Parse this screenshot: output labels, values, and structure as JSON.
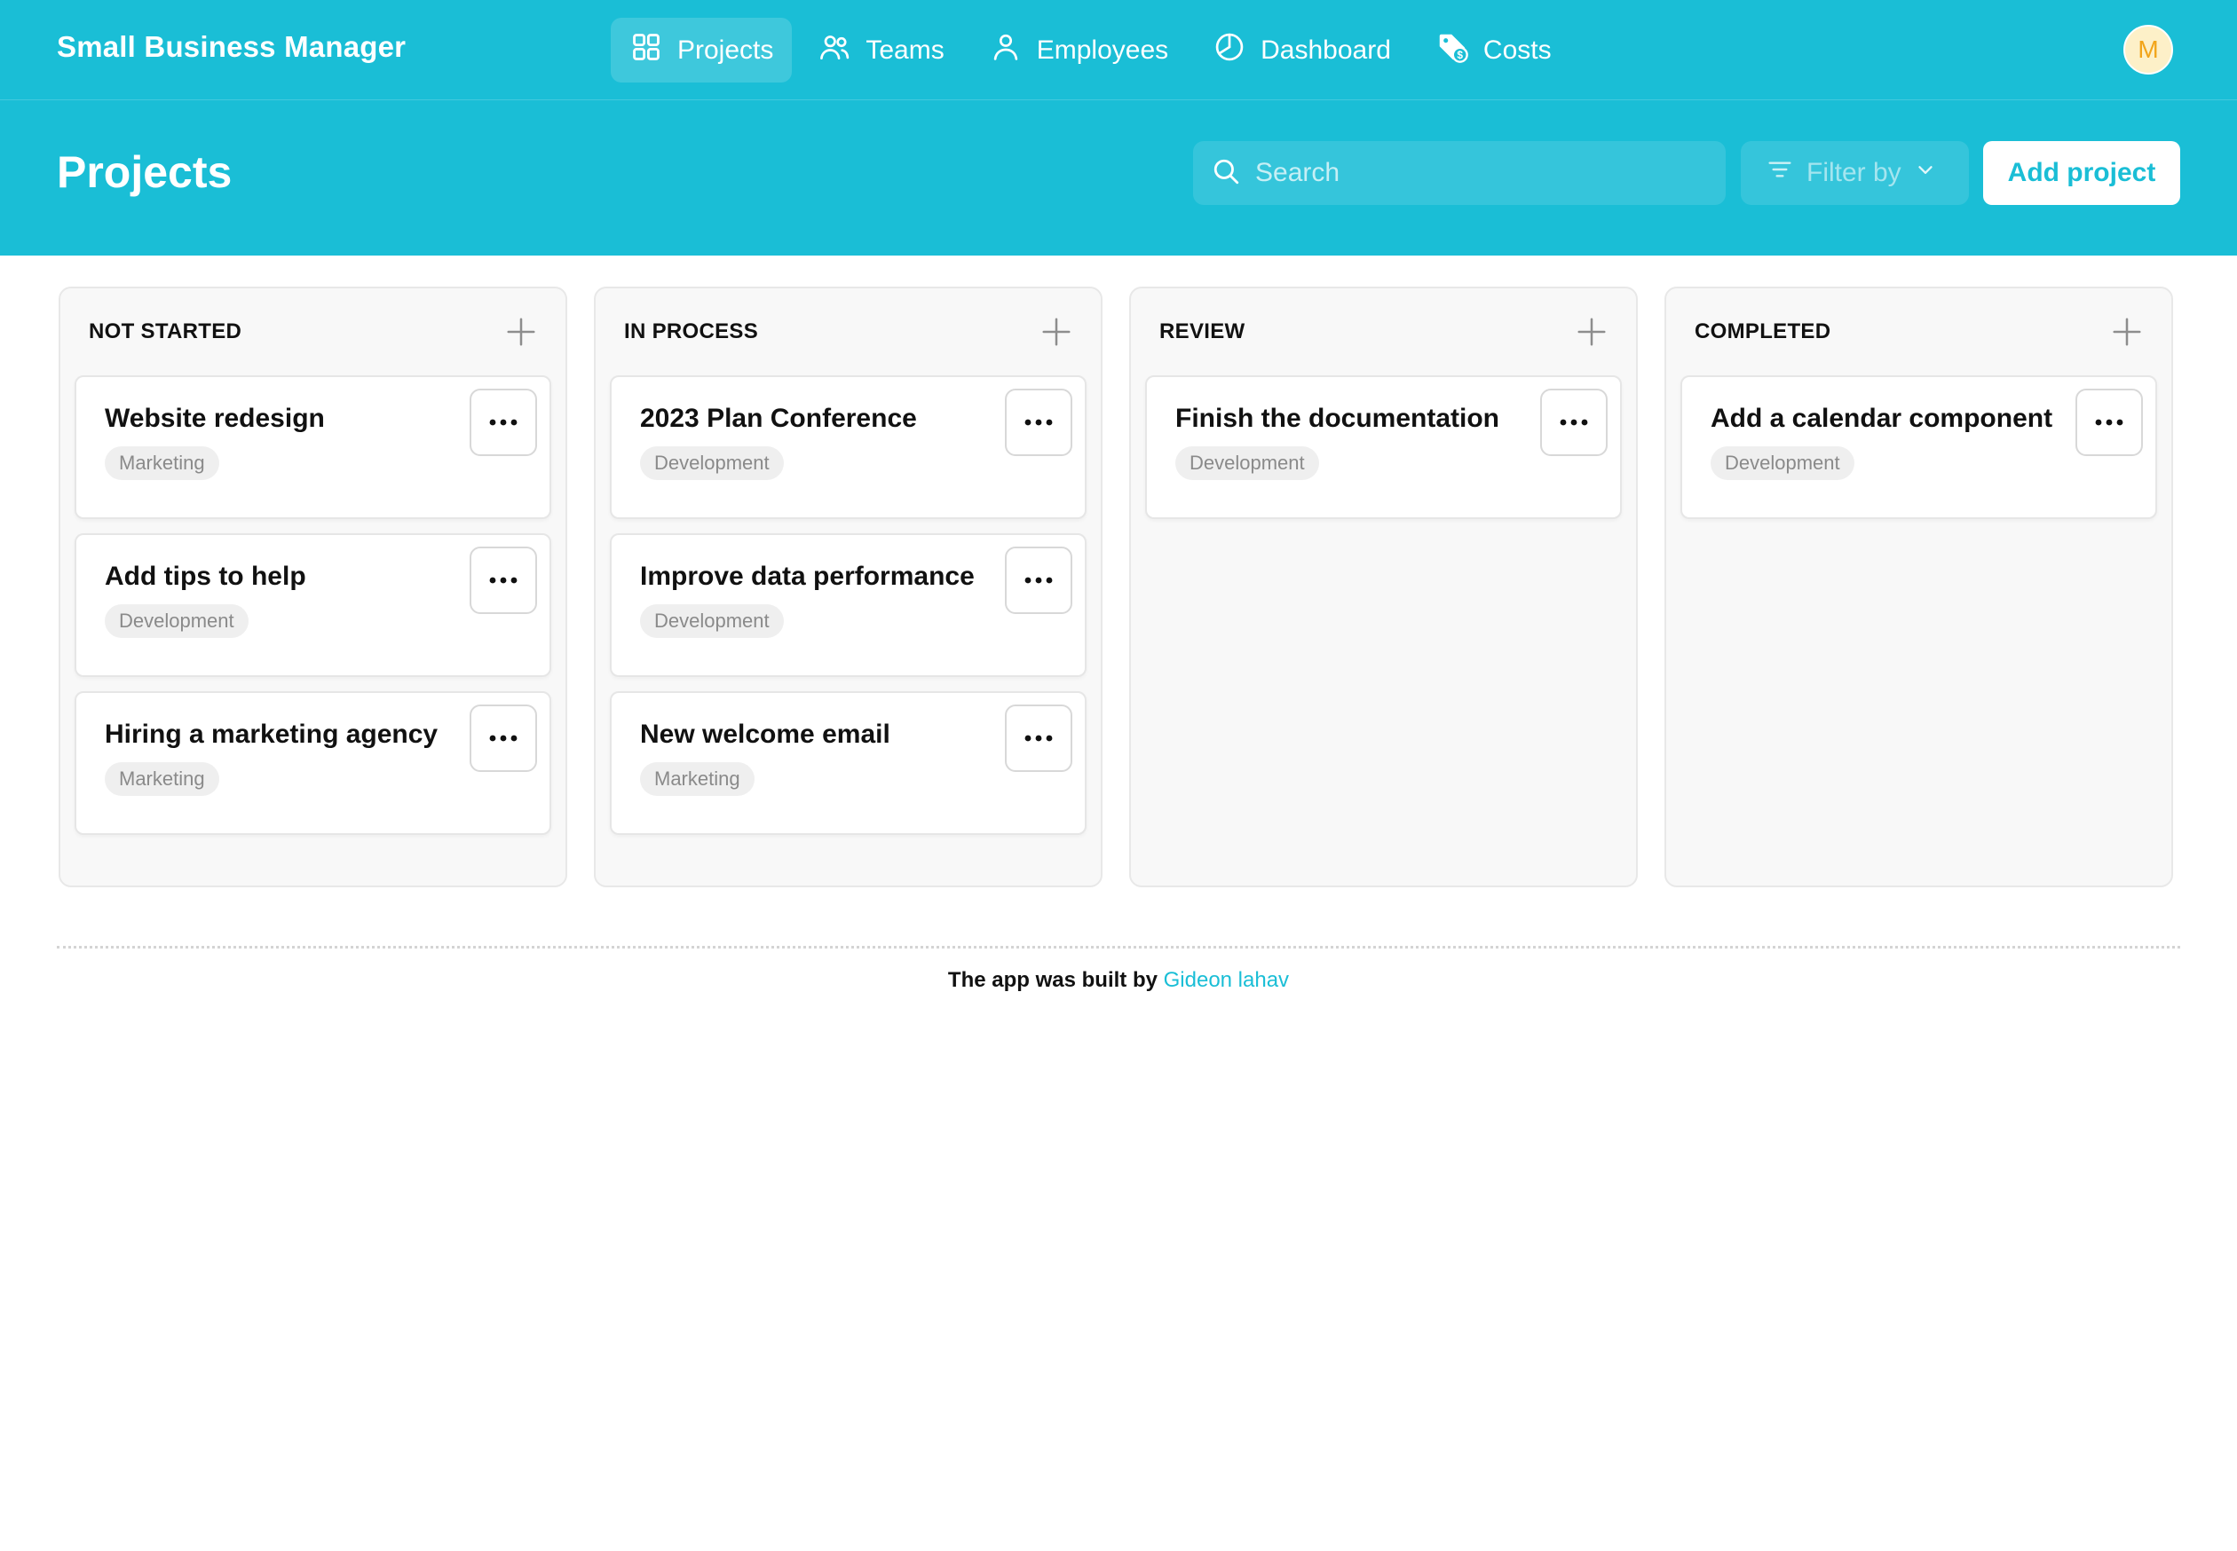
{
  "app": {
    "title": "Small Business Manager"
  },
  "nav": {
    "items": [
      {
        "label": "Projects",
        "icon": "grid-icon",
        "active": true
      },
      {
        "label": "Teams",
        "icon": "users-icon",
        "active": false
      },
      {
        "label": "Employees",
        "icon": "user-icon",
        "active": false
      },
      {
        "label": "Dashboard",
        "icon": "pie-chart-icon",
        "active": false
      },
      {
        "label": "Costs",
        "icon": "price-tag-icon",
        "active": false
      }
    ]
  },
  "user": {
    "avatar_initial": "M"
  },
  "page": {
    "title": "Projects"
  },
  "search": {
    "placeholder": "Search",
    "value": ""
  },
  "filter": {
    "label": "Filter by"
  },
  "actions": {
    "add_project": "Add project"
  },
  "columns": [
    {
      "title": "NOT STARTED",
      "cards": [
        {
          "title": "Website redesign",
          "tag": "Marketing"
        },
        {
          "title": "Add tips to help",
          "tag": "Development"
        },
        {
          "title": "Hiring a marketing agency",
          "tag": "Marketing"
        }
      ]
    },
    {
      "title": "IN PROCESS",
      "cards": [
        {
          "title": "2023 Plan Conference",
          "tag": "Development"
        },
        {
          "title": "Improve data performance",
          "tag": "Development"
        },
        {
          "title": "New welcome email",
          "tag": "Marketing"
        }
      ]
    },
    {
      "title": "REVIEW",
      "cards": [
        {
          "title": "Finish the documentation",
          "tag": "Development"
        }
      ]
    },
    {
      "title": "COMPLETED",
      "cards": [
        {
          "title": "Add a calendar component",
          "tag": "Development"
        }
      ]
    }
  ],
  "footer": {
    "text": "The app was built by",
    "author": "Gideon lahav"
  },
  "colors": {
    "accent": "#1abed6",
    "avatar_bg": "#fdf0c8",
    "avatar_fg": "#f2a51a",
    "tag_bg": "#efefef"
  }
}
